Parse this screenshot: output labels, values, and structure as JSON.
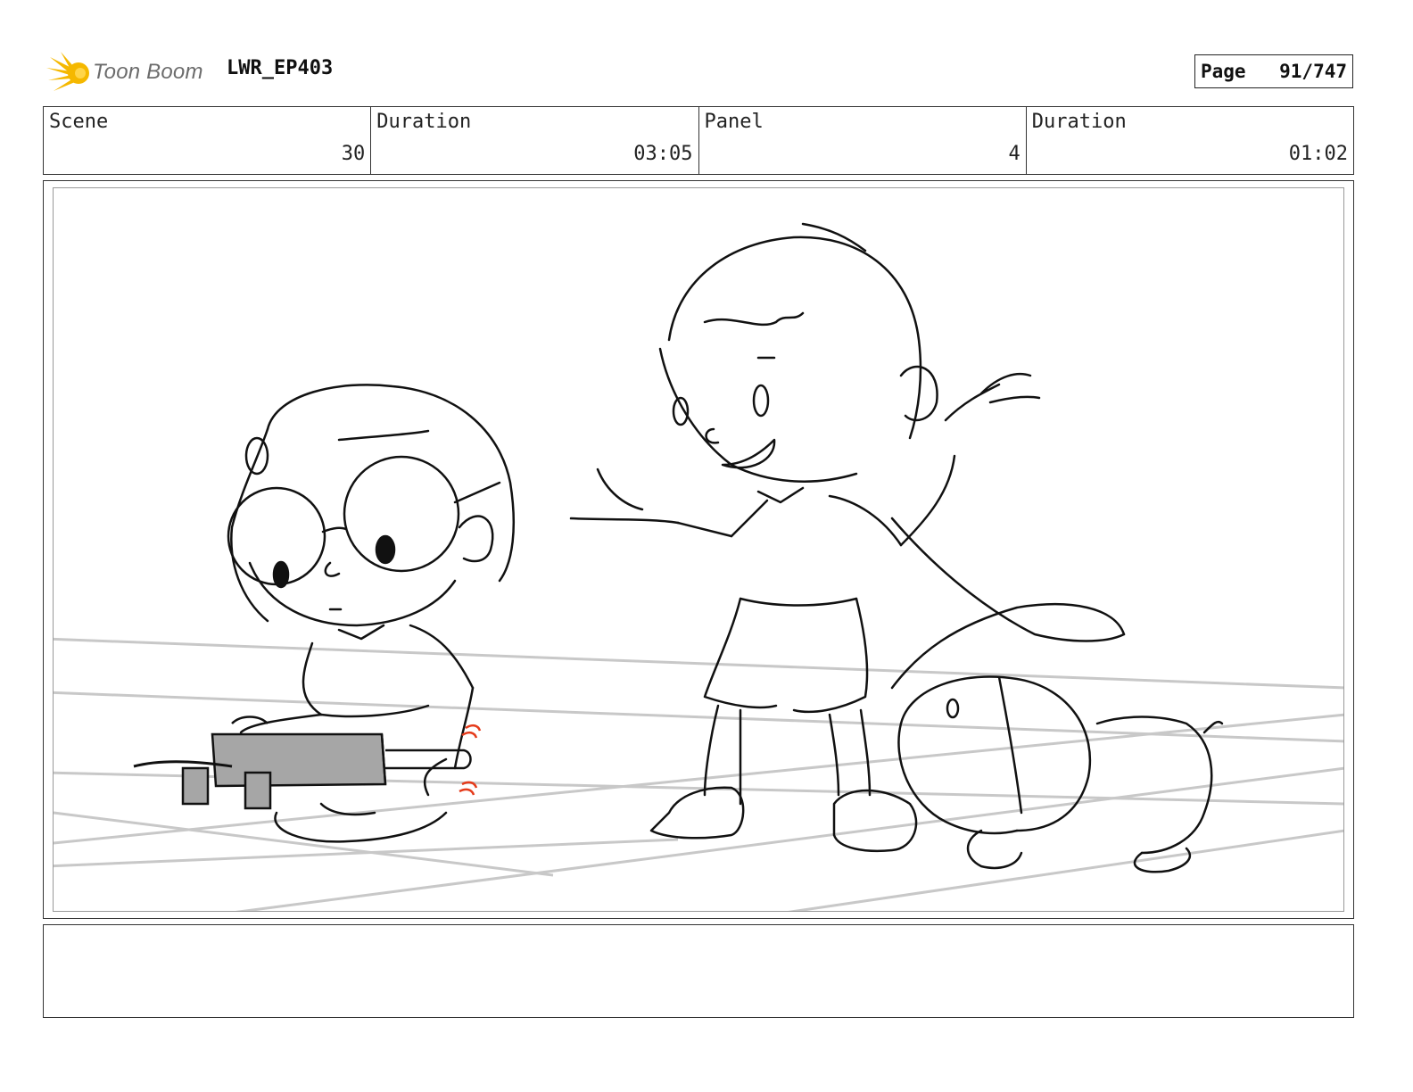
{
  "header": {
    "brand": "Toon Boom",
    "project": "LWR_EP403",
    "page_label": "Page",
    "page_value": "91/747"
  },
  "info": {
    "scene_label": "Scene",
    "scene_value": "30",
    "scene_duration_label": "Duration",
    "scene_duration_value": "03:05",
    "panel_label": "Panel",
    "panel_value": "4",
    "panel_duration_label": "Duration",
    "panel_duration_value": "01:02"
  },
  "notes": {
    "text": ""
  },
  "colors": {
    "logo_yellow": "#f5b800",
    "sketch_line": "#111111",
    "guide_gray": "#c8c8c8",
    "prop_gray": "#a6a6a6",
    "accent_red": "#e53b1b"
  }
}
